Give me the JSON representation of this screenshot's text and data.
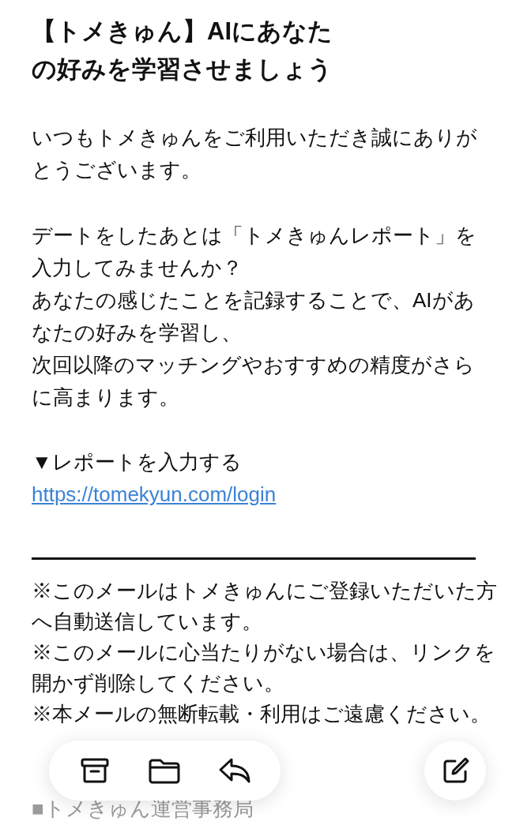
{
  "title": {
    "lines": [
      "【トメきゅん】AIにあなた",
      "の好みを学習させましょう"
    ]
  },
  "paragraphs": [
    {
      "lines": [
        "いつもトメきゅんをご利用いただき誠にありが",
        "とうございます。"
      ]
    },
    {
      "lines": [
        "デートをしたあとは「トメきゅんレポート」を",
        "入力してみませんか？",
        "あなたの感じたことを記録することで、AIがあ",
        "なたの好みを学習し、",
        "次回以降のマッチングやおすすめの精度がさら",
        "に高まります。"
      ]
    }
  ],
  "report": {
    "label": "▼レポートを入力する",
    "link": "https://tomekyun.com/login"
  },
  "notes": [
    {
      "lines": [
        "※このメールはトメきゅんにご登録いただいた方",
        "へ自動送信しています。"
      ]
    },
    {
      "lines": [
        "※このメールに心当たりがない場合は、リンクを",
        "開かず削除してください。"
      ]
    },
    {
      "lines": [
        "※本メールの無断転載・利用はご遠慮ください。"
      ]
    }
  ],
  "footer": {
    "sender": "■トメきゅん運営事務局"
  }
}
